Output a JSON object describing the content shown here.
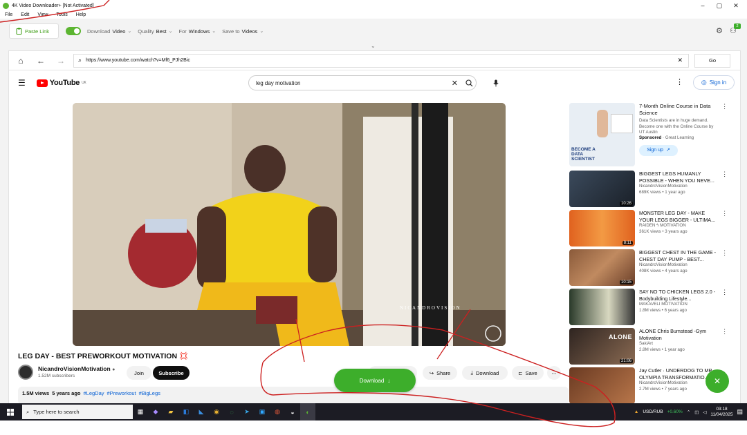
{
  "app": {
    "title": "4K Video Downloader+ [Not Activated]",
    "menu": [
      "File",
      "Edit",
      "View",
      "Tools",
      "Help"
    ],
    "window_controls": [
      "–",
      "▢",
      "✕"
    ]
  },
  "toolbar": {
    "paste_link": "Paste Link",
    "download_label": "Download",
    "download_value": "Video",
    "quality_label": "Quality",
    "quality_value": "Best",
    "for_label": "For",
    "for_value": "Windows",
    "save_to_label": "Save to",
    "save_to_value": "Videos",
    "badge_count": "2"
  },
  "browser": {
    "url": "https://www.youtube.com/watch?v=Mf6_PJh2Bic",
    "go_label": "Go"
  },
  "youtube": {
    "logo_text": "YouTube",
    "logo_region": "UK",
    "search_query": "leg day motivation",
    "signin_label": "Sign in",
    "video_watermark": "NICANDROVISION",
    "video_title": "LEG DAY - BEST PREWORKOUT MOTIVATION 💢",
    "channel_name": "NicandroVisionMotivation",
    "channel_subs": "1.52M subscribers",
    "join_label": "Join",
    "subscribe_label": "Subscribe",
    "share_label": "Share",
    "download_label": "Download",
    "save_label": "Save",
    "views": "1.5M views",
    "age": "5 years ago",
    "tags": [
      "#LegDay",
      "#Preworkout",
      "#BigLegs"
    ]
  },
  "overlay": {
    "download_button": "Download"
  },
  "sidebar": [
    {
      "title": "7-Month Online Course in Data Science",
      "desc": "Data Scientists are in huge demand. Become one with the Online Course by UT Austin",
      "sponsored": "Sponsored",
      "advertiser": "Great Learning",
      "cta": "Sign up",
      "thumb_text": "BECOME A DATA SCIENTIST"
    },
    {
      "title": "BIGGEST LEGS HUMANLY POSSIBLE - WHEN YOU NEVE...",
      "channel": "NicandroVisionMotivation",
      "views": "689K views",
      "age": "1 year ago",
      "duration": "10:26"
    },
    {
      "title": "MONSTER LEG DAY - MAKE YOUR LEGS BIGGER - ULTIMA...",
      "channel": "RAIDEN ϟ MOTIVATION",
      "views": "361K views",
      "age": "3 years ago",
      "duration": "8:11"
    },
    {
      "title": "BIGGEST CHEST IN THE GAME - CHEST DAY PUMP - BEST...",
      "channel": "NicandroVisionMotivation",
      "views": "408K views",
      "age": "4 years ago",
      "duration": "10:15"
    },
    {
      "title": "SAY NO TO CHICKEN LEGS 2.0 - Bodybuilding Lifestyle...",
      "channel": "MAKAVELI MOTIVATION",
      "views": "1.8M views",
      "age": "6 years ago",
      "duration": ""
    },
    {
      "title": "ALONE Chris Bumstead -Gym Motivation",
      "channel": "SakiArt",
      "views": "2.8M views",
      "age": "1 year ago",
      "duration": "21:06",
      "thumb_text": "ALONE"
    },
    {
      "title": "Jay Cutler · UNDERDOG TO MR. OLYMPIA TRANSFORMATIO...",
      "channel": "NicandroVisionMotivation",
      "views": "2.7M views",
      "age": "7 years ago",
      "duration": ""
    }
  ],
  "taskbar": {
    "search_placeholder": "Type here to search",
    "ticker": "USD/RUB",
    "ticker_change": "+0.60%",
    "time": "03:18",
    "date": "11/04/2025",
    "notif_count": "8"
  },
  "colors": {
    "accent_green": "#3dae2b",
    "yt_red": "#ff0000",
    "link_blue": "#065fd4",
    "taskbar": "#1c1c24"
  }
}
